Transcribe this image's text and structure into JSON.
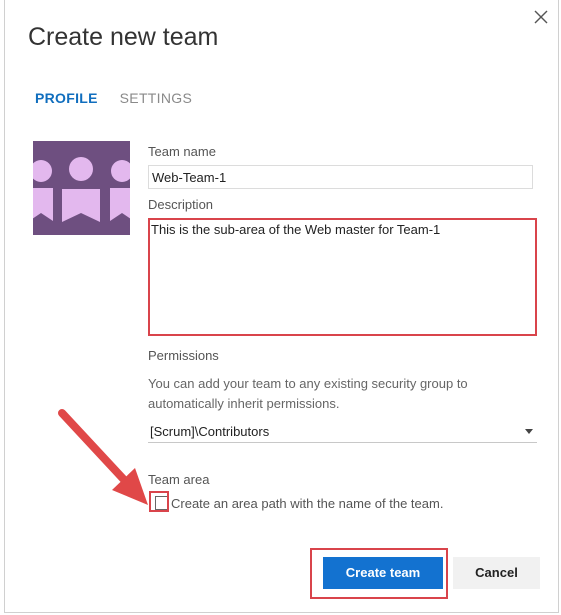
{
  "dialog": {
    "title": "Create new team",
    "tabs": [
      {
        "label": "PROFILE",
        "active": true
      },
      {
        "label": "SETTINGS",
        "active": false
      }
    ]
  },
  "profile": {
    "team_name_label": "Team name",
    "team_name_value": "Web-Team-1",
    "description_label": "Description",
    "description_value": "This is the sub-area of the Web master for Team-1",
    "permissions_label": "Permissions",
    "permissions_help": "You can add your team to any existing security group to automatically inherit permissions.",
    "permissions_selected": "[Scrum]\\Contributors",
    "team_area_label": "Team area",
    "team_area_checkbox_label": "Create an area path with the name of the team.",
    "team_area_checked": false
  },
  "buttons": {
    "create_label": "Create team",
    "cancel_label": "Cancel"
  },
  "colors": {
    "accent": "#1372d0",
    "highlight": "#d9444b",
    "avatar_bg": "#6e4f80",
    "avatar_figure": "#e3b8ee"
  },
  "icons": [
    "close-icon",
    "team-avatar-icon",
    "dropdown-caret-icon",
    "annotation-arrow-icon"
  ]
}
